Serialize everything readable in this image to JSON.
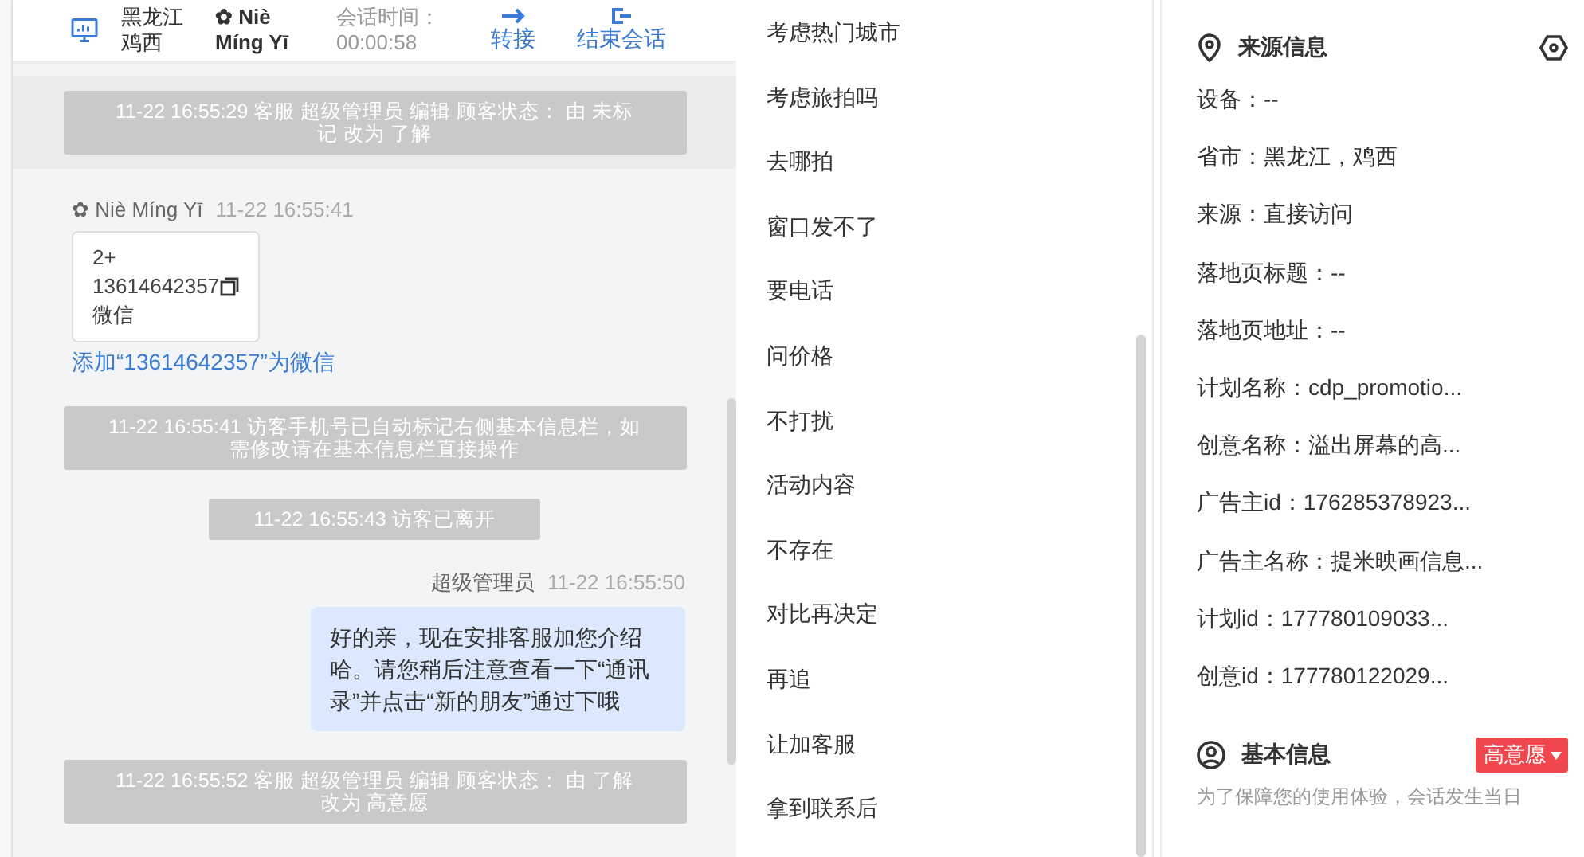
{
  "header": {
    "location": [
      "黑龙江",
      "鸡西"
    ],
    "visitor_name": [
      "✿ Niè",
      "Míng Yī"
    ],
    "session_time": {
      "label": "会话时间：",
      "value": "00:00:58"
    },
    "actions": [
      {
        "kind": "transfer",
        "label": "转接"
      },
      {
        "kind": "end",
        "label": "结束会话"
      }
    ]
  },
  "messages": [
    {
      "kind": "system",
      "highlighted": true,
      "text": "11-22 16:55:29 客服 超级管理员 编辑 顾客状态： 由 未标记 改为 了解"
    },
    {
      "kind": "visitor_card",
      "sender": "✿ Niè Míng Yī",
      "time": "11-22 16:55:41",
      "lines": [
        "2+",
        "13614642357",
        "微信"
      ],
      "link": "添加“13614642357”为微信"
    },
    {
      "kind": "system",
      "highlighted": false,
      "text": "11-22 16:55:41 访客手机号已自动标记右侧基本信息栏，如需修改请在基本信息栏直接操作"
    },
    {
      "kind": "system",
      "highlighted": false,
      "text": "11-22 16:55:43 访客已离开"
    },
    {
      "kind": "agent",
      "sender": "超级管理员",
      "time": "11-22 16:55:50",
      "text": "好的亲，现在安排客服加您介绍哈。请您稍后注意查看一下“通讯录”并点击“新的朋友”通过下哦"
    },
    {
      "kind": "system",
      "highlighted": false,
      "text": "11-22 16:55:52 客服 超级管理员 编辑 顾客状态： 由 了解改为 高意愿"
    }
  ],
  "quick_replies": [
    "考虑热门城市",
    "考虑旅拍吗",
    "去哪拍",
    "窗口发不了",
    "要电话",
    "问价格",
    "不打扰",
    "活动内容",
    "不存在",
    "对比再决定",
    "再追",
    "让加客服",
    "拿到联系后"
  ],
  "source_info": {
    "title": "来源信息",
    "rows": [
      "设备：--",
      "省市：黑龙江，鸡西",
      "来源：直接访问",
      "落地页标题：--",
      "落地页地址：--",
      "计划名称：cdp_promotio...",
      "创意名称：溢出屏幕的高...",
      "广告主id：176285378923...",
      "广告主名称：提米映画信息...",
      "计划id：177780109033...",
      "创意id：177780122029..."
    ]
  },
  "basic_info": {
    "title": "基本信息",
    "status": "高意愿",
    "notice": "为了保障您的使用体验，会话发生当日"
  }
}
